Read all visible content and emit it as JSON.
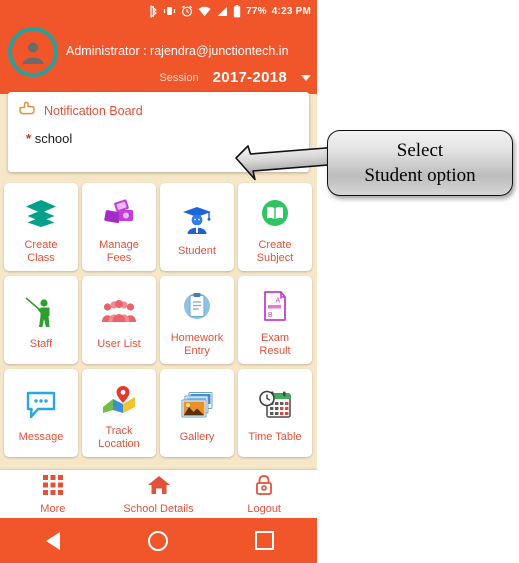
{
  "status_bar": {
    "battery_percent": "77%",
    "time": "4:23 PM",
    "icons": [
      "bluetooth-icon",
      "vibrate-icon",
      "alarm-icon",
      "wifi-icon",
      "signal-icon",
      "battery-icon"
    ]
  },
  "app_bar": {
    "avatar": "user-avatar-icon",
    "admin_text": "Administrator : rajendra@junctiontech.in",
    "session_label": "Session",
    "session_value": "2017-2018",
    "accent_color": "#f1562a",
    "avatar_ring_color": "#2f9e9b"
  },
  "notification_board": {
    "icon": "pointing-hand-icon",
    "title": "Notification Board",
    "items": [
      "school"
    ],
    "bullet": "*"
  },
  "grid": {
    "rows": [
      [
        {
          "label": "Create\nClass",
          "icon": "layers-icon",
          "color": "#00a08a"
        },
        {
          "label": "Manage\nFees",
          "icon": "money-icon",
          "color": "#b930c9"
        },
        {
          "label": "Student",
          "icon": "graduate-icon",
          "color": "#1f63d8"
        },
        {
          "label": "Create\nSubject",
          "icon": "open-book-icon",
          "color": "#2ec45f"
        }
      ],
      [
        {
          "label": "Staff",
          "icon": "teacher-pointer-icon",
          "color": "#2e9e2e"
        },
        {
          "label": "User List",
          "icon": "people-group-icon",
          "color": "#e8636b"
        },
        {
          "label": "Homework\nEntry",
          "icon": "clipboard-icon",
          "color": "#5aa7d8"
        },
        {
          "label": "Exam\nResult",
          "icon": "grade-sheet-icon",
          "color": "#c03fd0"
        }
      ],
      [
        {
          "label": "Message",
          "icon": "speech-bubble-icon",
          "color": "#27a8e0"
        },
        {
          "label": "Track\nLocation",
          "icon": "map-pin-icon",
          "color": "#e23b2e"
        },
        {
          "label": "Gallery",
          "icon": "photos-icon",
          "color": "#3c87c7"
        },
        {
          "label": "Time Table",
          "icon": "calendar-clock-icon",
          "color": "#3f3f3f"
        }
      ]
    ]
  },
  "bottom_bar": {
    "items": [
      {
        "label": "More",
        "icon": "grid-menu-icon"
      },
      {
        "label": "School Details",
        "icon": "home-icon"
      },
      {
        "label": "Logout",
        "icon": "lock-icon"
      }
    ],
    "label_color": "#e0523a"
  },
  "nav_bar": {
    "back": "back-triangle-icon",
    "home": "home-circle-icon",
    "recents": "recents-square-icon"
  },
  "annotation": {
    "line1": "Select",
    "line2": "Student option",
    "arrow": "callout-arrow-icon",
    "points_to": "Student"
  }
}
